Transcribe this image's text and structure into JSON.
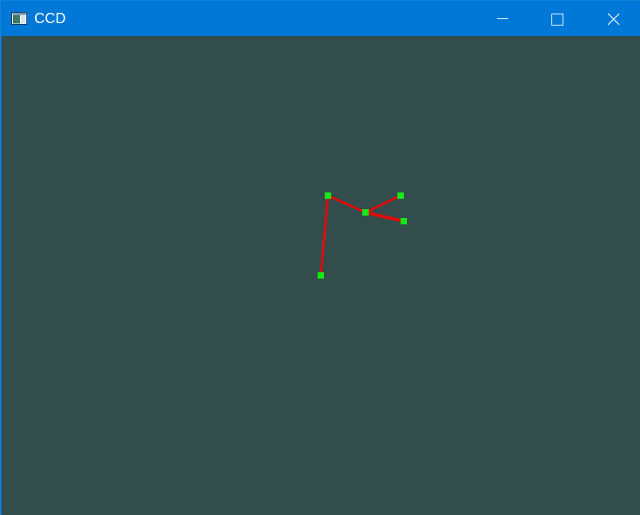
{
  "window": {
    "title": "CCD",
    "icon": "app-window-icon",
    "controls": {
      "minimize_icon": "minimize-icon",
      "maximize_icon": "maximize-icon",
      "close_icon": "close-icon"
    }
  },
  "colors": {
    "titlebar": "#0078d7",
    "background": "#334d4d",
    "segment": "#e00b0b",
    "joint": "#16e816",
    "title_text": "#ffffff"
  },
  "scene": {
    "description_free": true,
    "joints": [
      {
        "id": "base"
      },
      {
        "id": "elbow"
      },
      {
        "id": "wrist"
      },
      {
        "id": "end-effector"
      },
      {
        "id": "target"
      }
    ]
  }
}
